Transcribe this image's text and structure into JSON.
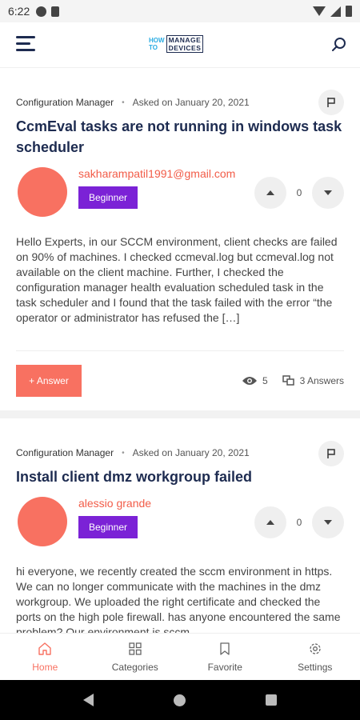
{
  "status_bar": {
    "time": "6:22"
  },
  "app_bar": {
    "logo": {
      "how": "HOW",
      "to": "TO",
      "manage": "MANAGE",
      "devices": "DEVICES"
    }
  },
  "questions": [
    {
      "category": "Configuration Manager",
      "asked": "Asked on January 20, 2021",
      "title": "CcmEval tasks are not running in windows task scheduler",
      "author": "sakharampatil1991@gmail.com",
      "level": "Beginner",
      "votes": "0",
      "excerpt": "Hello Experts, in our SCCM environment, client checks are failed on 90% of machines. I checked ccmeval.log  but ccmeval.log not available on the client machine. Further, I checked the configuration manager health evaluation scheduled task in the task scheduler and I found that the task failed with the error “the operator or administrator has refused the […]",
      "answer_label": "+ Answer",
      "views": "5",
      "answers": "3 Answers"
    },
    {
      "category": "Configuration Manager",
      "asked": "Asked on January 20, 2021",
      "title": "Install client dmz workgroup failed",
      "author": "alessio grande",
      "level": "Beginner",
      "votes": "0",
      "excerpt": "hi everyone, we recently created the sccm environment in https. We can no longer communicate with the machines in the dmz workgroup. We uploaded the right certificate and checked the ports on the high pole firewall. has anyone encountered the same problem? Our environment is sccm"
    }
  ],
  "bottom_nav": [
    {
      "label": "Home",
      "icon": "home-icon",
      "active": true
    },
    {
      "label": "Categories",
      "icon": "categories-icon",
      "active": false
    },
    {
      "label": "Favorite",
      "icon": "bookmark-icon",
      "active": false
    },
    {
      "label": "Settings",
      "icon": "gear-icon",
      "active": false
    }
  ],
  "colors": {
    "accent": "#f87161",
    "author": "#f25c48",
    "badge": "#7b22d6",
    "title": "#1d2b50"
  }
}
